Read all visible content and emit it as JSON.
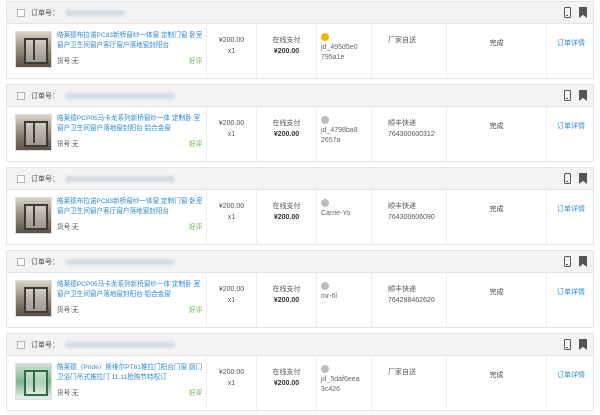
{
  "orders": [
    {
      "order_label": "订单号：",
      "product_name": "皓莱德布拉诺PC83新桥窗纱一体窗 定制门窗 卧室窗户卫生间窗户客厅窗户落地窗封阳台",
      "spec": "货号:无",
      "review": "好评",
      "price": "¥200.00",
      "qty": "x1",
      "pay_method": "在线支付",
      "pay_amount": "¥200.00",
      "user": "jd_495d5e0795a1e",
      "avatar": "vip",
      "ship_method": "厂家自送",
      "tracking": "",
      "status": "完成",
      "detail_label": "订单详情",
      "thumb": "room"
    },
    {
      "order_label": "订单号：",
      "product_name": "皓莱德PCP05马卡龙系列新桥窗纱一体 定制卧 室窗户卫生间窗户落地窗封阳台 铝合金窗",
      "spec": "货号:无",
      "review": "好评",
      "price": "¥200.00",
      "qty": "x1",
      "pay_method": "在线支付",
      "pay_amount": "¥200.00",
      "user": "jd_4798ba82657a",
      "avatar": "default",
      "ship_method": "顺丰快递",
      "tracking": "764300600312",
      "status": "完成",
      "detail_label": "订单详情",
      "thumb": "room"
    },
    {
      "order_label": "订单号：",
      "product_name": "皓莱德布拉诺PC83新桥窗纱一体窗 定制门窗 卧室窗户卫生间窗户客厅窗户落地窗封阳台",
      "spec": "货号:无",
      "review": "好评",
      "price": "¥200.00",
      "qty": "x1",
      "pay_method": "在线支付",
      "pay_amount": "¥200.00",
      "user": "Carrie-Yo",
      "avatar": "default",
      "ship_method": "顺丰快递",
      "tracking": "764300606090",
      "status": "完成",
      "detail_label": "订单详情",
      "thumb": "room"
    },
    {
      "order_label": "订单号：",
      "product_name": "皓莱德PCP05马卡龙系列新桥窗纱一体 定制卧 室窗户卫生间窗户落地窗封阳台 铝合金窗",
      "spec": "货号:无",
      "review": "好评",
      "price": "¥200.00",
      "qty": "x1",
      "pay_method": "在线支付",
      "pay_amount": "¥200.00",
      "user": "mr-6l",
      "avatar": "default",
      "ship_method": "顺丰快递",
      "tracking": "764288462620",
      "status": "完成",
      "detail_label": "订单详情",
      "thumb": "room"
    },
    {
      "order_label": "订单号：",
      "product_name": "皓莱德（Pride）斯维尔PT81推拉门阳台门窗 厨门卫浴门吊式推拉门 11.11抢购节特权订",
      "spec": "货号:无",
      "review": "好评",
      "price": "¥200.00",
      "qty": "x1",
      "pay_method": "在线支付",
      "pay_amount": "¥200.00",
      "user": "jd_5daf6eea3c426",
      "avatar": "default",
      "ship_method": "厂家自送",
      "tracking": "",
      "status": "完成",
      "detail_label": "订单详情",
      "thumb": "green"
    }
  ]
}
